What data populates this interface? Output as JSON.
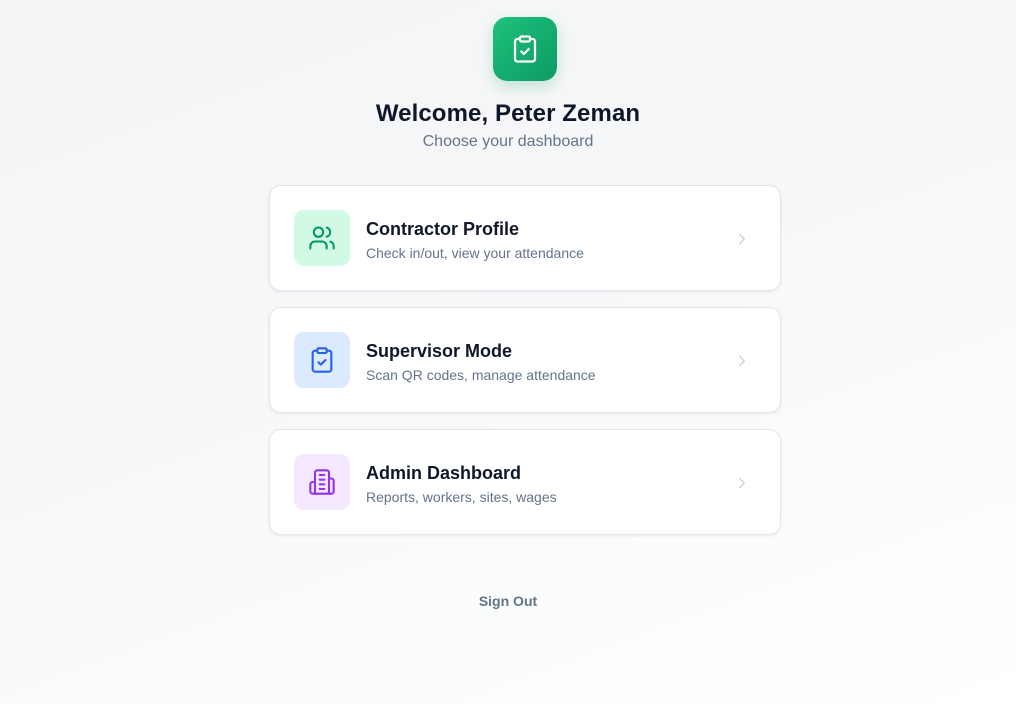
{
  "header": {
    "logo_icon": "clipboard-check-icon",
    "title": "Welcome, Peter Zeman",
    "subtitle": "Choose your dashboard"
  },
  "options": [
    {
      "title": "Contractor Profile",
      "description": "Check in/out, view your attendance",
      "icon": "users-icon",
      "icon_bg": "#d1fae5",
      "icon_color": "#059669"
    },
    {
      "title": "Supervisor Mode",
      "description": "Scan QR codes, manage attendance",
      "icon": "clipboard-check-icon",
      "icon_bg": "#dbeafe",
      "icon_color": "#2563eb"
    },
    {
      "title": "Admin Dashboard",
      "description": "Reports, workers, sites, wages",
      "icon": "building-icon",
      "icon_bg": "#f3e8ff",
      "icon_color": "#9333ea"
    }
  ],
  "sign_out_label": "Sign Out",
  "colors": {
    "brand_green": "#10b07a",
    "title": "#0f172a",
    "muted": "#64748b",
    "chevron": "#cbd5e1"
  }
}
